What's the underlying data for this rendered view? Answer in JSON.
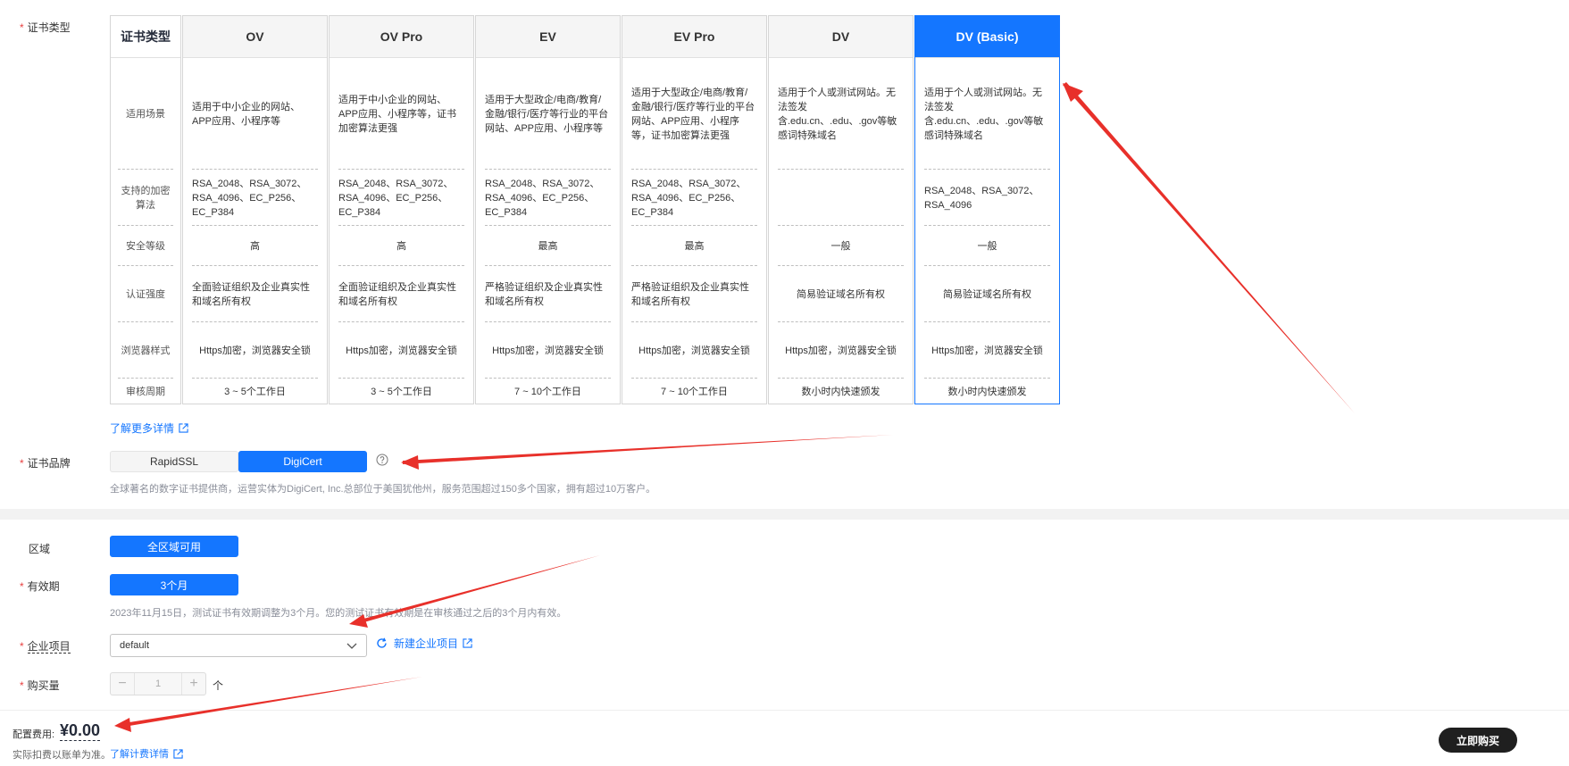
{
  "form": {
    "cert_type_label": "证书类型",
    "brand_label": "证书品牌",
    "region_label": "区域",
    "validity_label": "有效期",
    "project_label": "企业项目",
    "quantity_label": "购买量",
    "required_mark": "*"
  },
  "cert_table": {
    "header": "证书类型",
    "row_labels": [
      "适用场景",
      "支持的加密算法",
      "安全等级",
      "认证强度",
      "浏览器样式",
      "审核周期"
    ],
    "plans": [
      {
        "name": "OV",
        "scenario": "适用于中小企业的网站、APP应用、小程序等",
        "algorithms": "RSA_2048、RSA_3072、RSA_4096、EC_P256、EC_P384",
        "security": "高",
        "validation": "全面验证组织及企业真实性和域名所有权",
        "browser": "Https加密，浏览器安全锁",
        "review": "3 ~ 5个工作日"
      },
      {
        "name": "OV Pro",
        "scenario": "适用于中小企业的网站、APP应用、小程序等，证书加密算法更强",
        "algorithms": "RSA_2048、RSA_3072、RSA_4096、EC_P256、EC_P384",
        "security": "高",
        "validation": "全面验证组织及企业真实性和域名所有权",
        "browser": "Https加密，浏览器安全锁",
        "review": "3 ~ 5个工作日"
      },
      {
        "name": "EV",
        "scenario": "适用于大型政企/电商/教育/金融/银行/医疗等行业的平台网站、APP应用、小程序等",
        "algorithms": "RSA_2048、RSA_3072、RSA_4096、EC_P256、EC_P384",
        "security": "最高",
        "validation": "严格验证组织及企业真实性和域名所有权",
        "browser": "Https加密，浏览器安全锁",
        "review": "7 ~ 10个工作日"
      },
      {
        "name": "EV Pro",
        "scenario": "适用于大型政企/电商/教育/金融/银行/医疗等行业的平台网站、APP应用、小程序等，证书加密算法更强",
        "algorithms": "RSA_2048、RSA_3072、RSA_4096、EC_P256、EC_P384",
        "security": "最高",
        "validation": "严格验证组织及企业真实性和域名所有权",
        "browser": "Https加密，浏览器安全锁",
        "review": "7 ~ 10个工作日"
      },
      {
        "name": "DV",
        "scenario": "适用于个人或测试网站。无法签发含.edu.cn、.edu、.gov等敏感词特殊域名",
        "algorithms": "",
        "security": "一般",
        "validation": "简易验证域名所有权",
        "browser": "Https加密，浏览器安全锁",
        "review": "数小时内快速颁发"
      },
      {
        "name": "DV (Basic)",
        "scenario": "适用于个人或测试网站。无法签发含.edu.cn、.edu、.gov等敏感词特殊域名",
        "algorithms": "RSA_2048、RSA_3072、RSA_4096",
        "security": "一般",
        "validation": "简易验证域名所有权",
        "browser": "Https加密，浏览器安全锁",
        "review": "数小时内快速颁发",
        "selected": true
      }
    ]
  },
  "learn_more": "了解更多详情",
  "brand": {
    "options": [
      "RapidSSL",
      "DigiCert"
    ],
    "selected": "DigiCert",
    "description": "全球著名的数字证书提供商，运营实体为DigiCert, Inc.总部位于美国犹他州，服务范围超过150多个国家，拥有超过10万客户。"
  },
  "region": {
    "value": "全区域可用"
  },
  "validity": {
    "value": "3个月",
    "note": "2023年11月15日，测试证书有效期调整为3个月。您的测试证书有效期是在审核通过之后的3个月内有效。"
  },
  "project": {
    "value": "default",
    "new_link": "新建企业项目"
  },
  "quantity": {
    "value": "1",
    "unit": "个"
  },
  "footer": {
    "fee_label": "配置费用:",
    "price": "¥0.00",
    "note": "实际扣费以账单为准。",
    "billing_link": "了解计费详情",
    "buy_button": "立即购买"
  },
  "colors": {
    "accent": "#1476ff",
    "required": "#e84141",
    "annotation_arrow": "#e8302a",
    "buy_button": "#1f1f1f"
  }
}
